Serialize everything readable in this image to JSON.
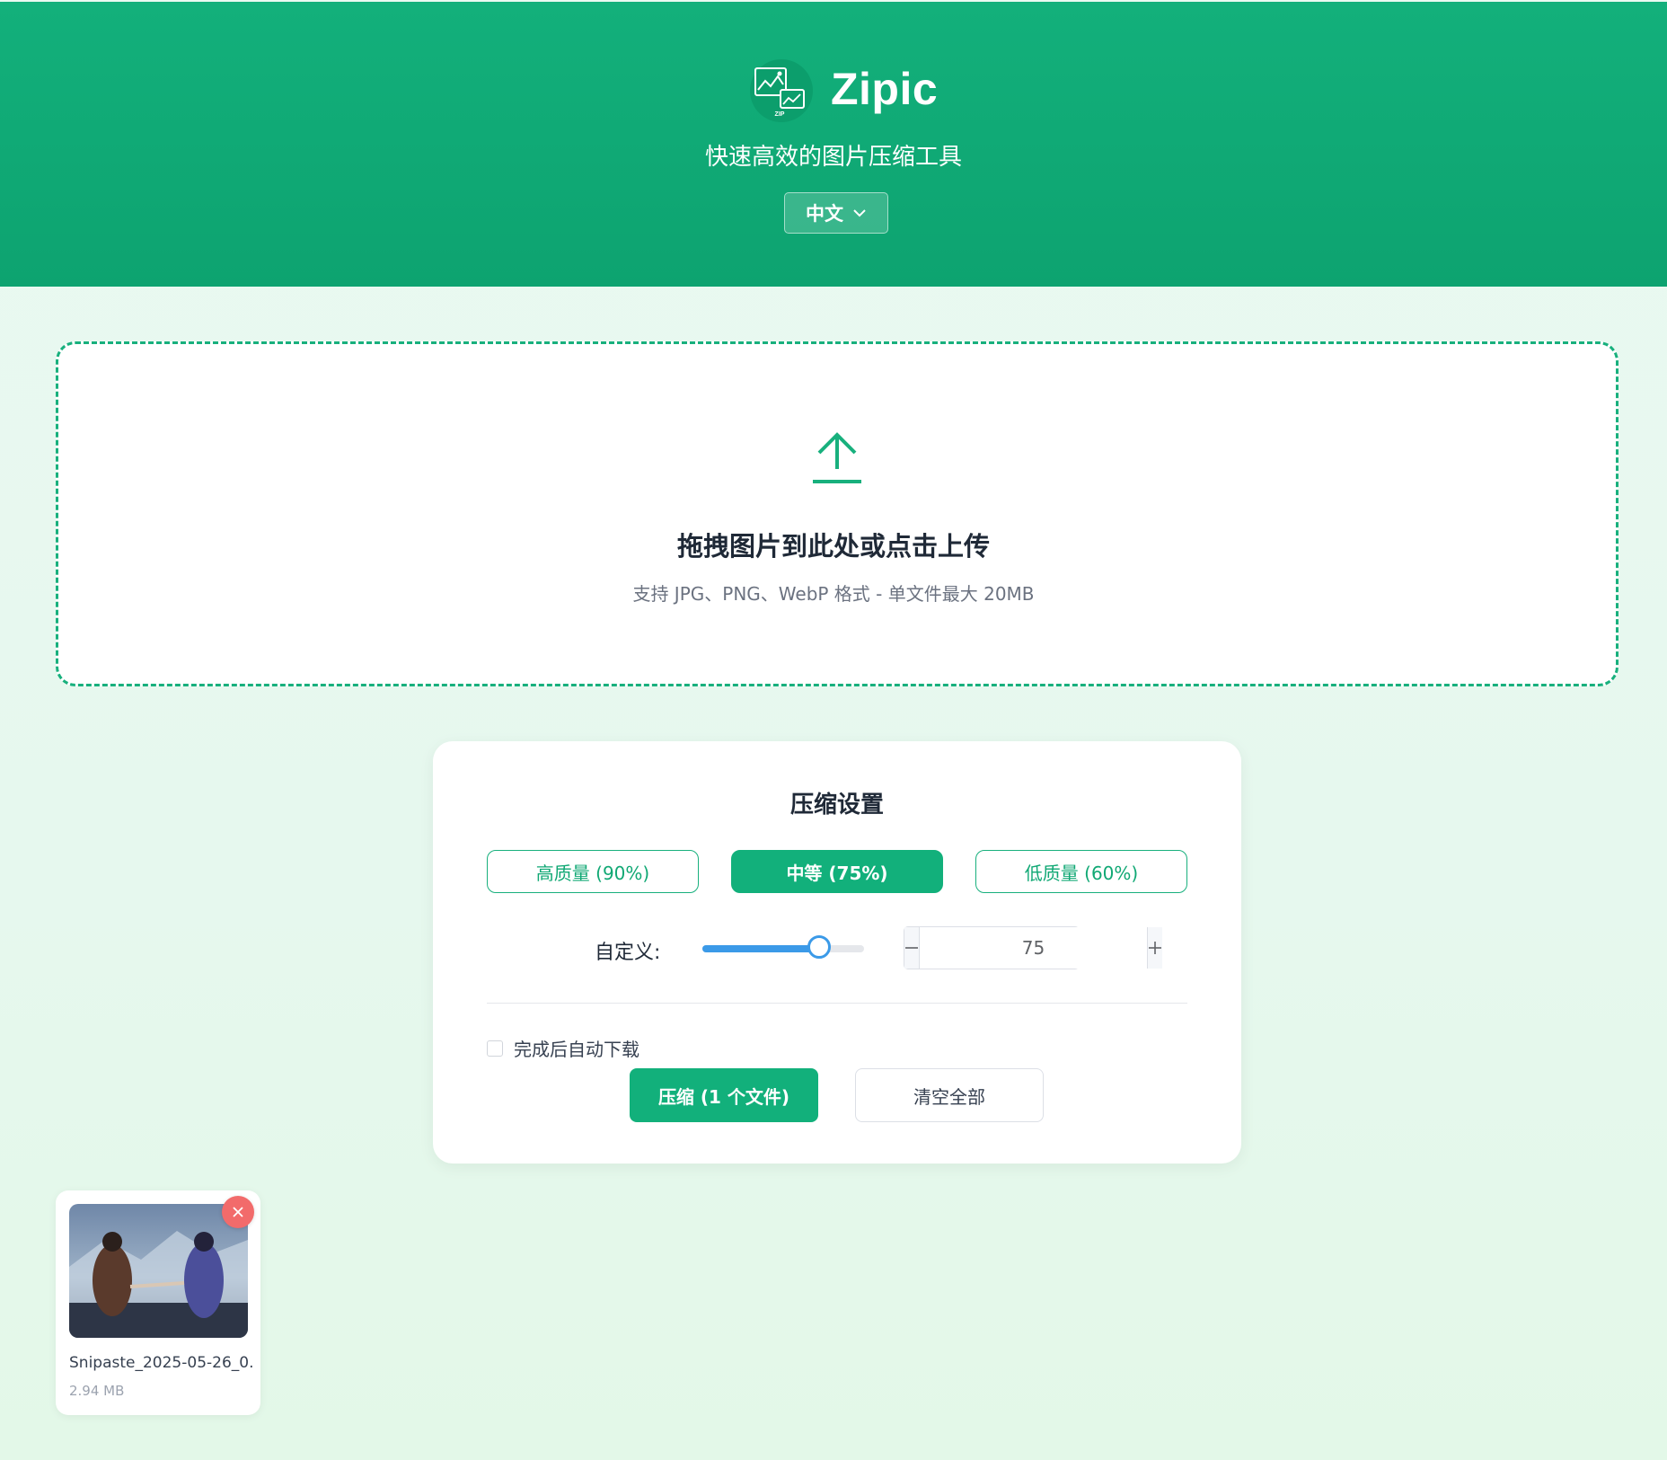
{
  "header": {
    "app_name": "Zipic",
    "logo_text": "ZIP",
    "subtitle": "快速高效的图片压缩工具",
    "language_label": "中文"
  },
  "dropzone": {
    "title": "拖拽图片到此处或点击上传",
    "hint": "支持 JPG、PNG、WebP 格式 - 单文件最大 20MB"
  },
  "settings": {
    "title": "压缩设置",
    "presets": [
      {
        "label": "高质量 (90%)",
        "active": false
      },
      {
        "label": "中等 (75%)",
        "active": true
      },
      {
        "label": "低质量 (60%)",
        "active": false
      }
    ],
    "custom_label": "自定义:",
    "quality_value": "75",
    "slider_fraction": 0.72,
    "auto_download_label": "完成后自动下载",
    "auto_download_checked": false,
    "compress_button": "压缩 (1 个文件)",
    "clear_button": "清空全部"
  },
  "files": [
    {
      "name": "Snipaste_2025-05-26_0...",
      "size": "2.94 MB"
    }
  ],
  "colors": {
    "brand": "#12b07b",
    "slider": "#3b9ae8",
    "remove": "#f26b6b"
  }
}
